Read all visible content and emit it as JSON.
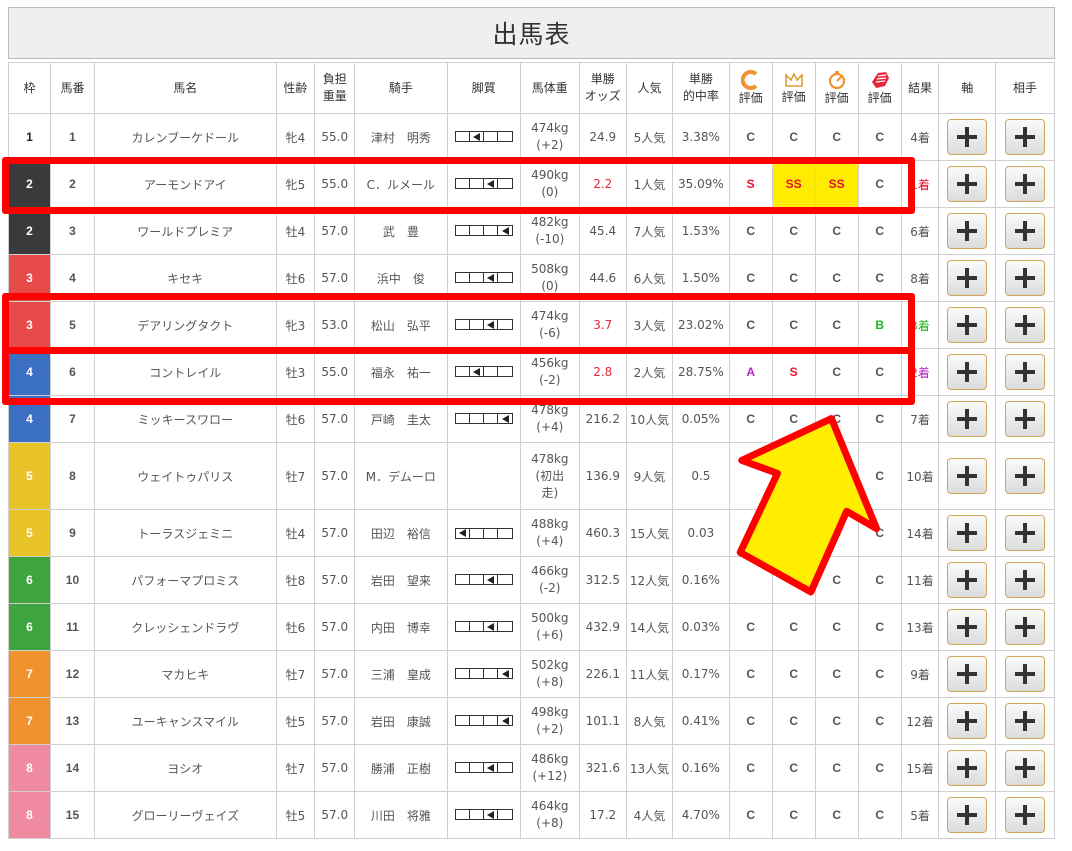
{
  "title": "出馬表",
  "headers": {
    "waku": "枠",
    "umaban": "馬番",
    "name": "馬名",
    "sexage": "性齢",
    "futan_1": "負担",
    "futan_2": "重量",
    "jockey": "騎手",
    "kyakushitsu": "脚質",
    "weight": "馬体重",
    "odds_1": "単勝",
    "odds_2": "オッズ",
    "pop": "人気",
    "hit_1": "単勝",
    "hit_2": "的中率",
    "eval": "評価",
    "result": "結果",
    "axis": "軸",
    "partner": "相手"
  },
  "header_icons": [
    "c-logo-icon",
    "crown-icon",
    "pot-icon",
    "fist-icon"
  ],
  "waku_colors": {
    "1": "#ffffff",
    "2": "#3a3a3a",
    "3": "#e84a4a",
    "4": "#3b6fc4",
    "5": "#e8c42a",
    "6": "#3ea53e",
    "7": "#f0922e",
    "8": "#f08aa0"
  },
  "rows": [
    {
      "waku": "1",
      "umaban": "1",
      "name": "カレンブーケドール",
      "sexage": "牝4",
      "futan": "55.0",
      "jockey": "津村　明秀",
      "kyaku": 2,
      "weight_1": "474kg",
      "weight_2": "(+2)",
      "odds": "24.9",
      "hot": false,
      "pop": "5人気",
      "hit": "3.38%",
      "g1": "C",
      "g2": "C",
      "g3": "C",
      "g4": "C",
      "result": "4着"
    },
    {
      "waku": "2",
      "umaban": "2",
      "name": "アーモンドアイ",
      "sexage": "牝5",
      "futan": "55.0",
      "jockey": "C．ルメール",
      "kyaku": 3,
      "weight_1": "490kg",
      "weight_2": "(0)",
      "odds": "2.2",
      "hot": true,
      "pop": "1人気",
      "hit": "35.09%",
      "g1": "S",
      "g2": "SS",
      "g3": "SS",
      "g4": "C",
      "result": "1着"
    },
    {
      "waku": "2",
      "umaban": "3",
      "name": "ワールドプレミア",
      "sexage": "牡4",
      "futan": "57.0",
      "jockey": "武　豊",
      "kyaku": 4,
      "weight_1": "482kg",
      "weight_2": "(-10)",
      "odds": "45.4",
      "hot": false,
      "pop": "7人気",
      "hit": "1.53%",
      "g1": "C",
      "g2": "C",
      "g3": "C",
      "g4": "C",
      "result": "6着"
    },
    {
      "waku": "3",
      "umaban": "4",
      "name": "キセキ",
      "sexage": "牡6",
      "futan": "57.0",
      "jockey": "浜中　俊",
      "kyaku": 3,
      "weight_1": "508kg",
      "weight_2": "(0)",
      "odds": "44.6",
      "hot": false,
      "pop": "6人気",
      "hit": "1.50%",
      "g1": "C",
      "g2": "C",
      "g3": "C",
      "g4": "C",
      "result": "8着"
    },
    {
      "waku": "3",
      "umaban": "5",
      "name": "デアリングタクト",
      "sexage": "牝3",
      "futan": "53.0",
      "jockey": "松山　弘平",
      "kyaku": 3,
      "weight_1": "474kg",
      "weight_2": "(-6)",
      "odds": "3.7",
      "hot": true,
      "pop": "3人気",
      "hit": "23.02%",
      "g1": "C",
      "g2": "C",
      "g3": "C",
      "g4": "B",
      "result": "3着"
    },
    {
      "waku": "4",
      "umaban": "6",
      "name": "コントレイル",
      "sexage": "牡3",
      "futan": "55.0",
      "jockey": "福永　祐一",
      "kyaku": 2,
      "weight_1": "456kg",
      "weight_2": "(-2)",
      "odds": "2.8",
      "hot": true,
      "pop": "2人気",
      "hit": "28.75%",
      "g1": "A",
      "g2": "S",
      "g3": "C",
      "g4": "C",
      "result": "2着"
    },
    {
      "waku": "4",
      "umaban": "7",
      "name": "ミッキースワロー",
      "sexage": "牡6",
      "futan": "57.0",
      "jockey": "戸崎　圭太",
      "kyaku": 4,
      "weight_1": "478kg",
      "weight_2": "(+4)",
      "odds": "216.2",
      "hot": false,
      "pop": "10人気",
      "hit": "0.05%",
      "g1": "C",
      "g2": "C",
      "g3": "C",
      "g4": "C",
      "result": "7着"
    },
    {
      "waku": "5",
      "umaban": "8",
      "name": "ウェイトゥパリス",
      "sexage": "牡7",
      "futan": "57.0",
      "jockey": "M．デムーロ",
      "kyaku": 0,
      "weight_1": "478kg",
      "weight_2": "(初出",
      "weight_3": "走)",
      "odds": "136.9",
      "hot": false,
      "pop": "9人気",
      "hit": "0.5",
      "g1": "",
      "g2": "",
      "g3": "C",
      "g4": "C",
      "result": "10着"
    },
    {
      "waku": "5",
      "umaban": "9",
      "name": "トーラスジェミニ",
      "sexage": "牡4",
      "futan": "57.0",
      "jockey": "田辺　裕信",
      "kyaku": 1,
      "weight_1": "488kg",
      "weight_2": "(+4)",
      "odds": "460.3",
      "hot": false,
      "pop": "15人気",
      "hit": "0.03",
      "g1": "",
      "g2": "",
      "g3": "C",
      "g4": "C",
      "result": "14着"
    },
    {
      "waku": "6",
      "umaban": "10",
      "name": "パフォーマプロミス",
      "sexage": "牡8",
      "futan": "57.0",
      "jockey": "岩田　望来",
      "kyaku": 3,
      "weight_1": "466kg",
      "weight_2": "(-2)",
      "odds": "312.5",
      "hot": false,
      "pop": "12人気",
      "hit": "0.16%",
      "g1": "",
      "g2": "",
      "g3": "C",
      "g4": "C",
      "result": "11着"
    },
    {
      "waku": "6",
      "umaban": "11",
      "name": "クレッシェンドラヴ",
      "sexage": "牡6",
      "futan": "57.0",
      "jockey": "内田　博幸",
      "kyaku": 3,
      "weight_1": "500kg",
      "weight_2": "(+6)",
      "odds": "432.9",
      "hot": false,
      "pop": "14人気",
      "hit": "0.03%",
      "g1": "C",
      "g2": "C",
      "g3": "C",
      "g4": "C",
      "result": "13着"
    },
    {
      "waku": "7",
      "umaban": "12",
      "name": "マカヒキ",
      "sexage": "牡7",
      "futan": "57.0",
      "jockey": "三浦　皇成",
      "kyaku": 4,
      "weight_1": "502kg",
      "weight_2": "(+8)",
      "odds": "226.1",
      "hot": false,
      "pop": "11人気",
      "hit": "0.17%",
      "g1": "C",
      "g2": "C",
      "g3": "C",
      "g4": "C",
      "result": "9着"
    },
    {
      "waku": "7",
      "umaban": "13",
      "name": "ユーキャンスマイル",
      "sexage": "牡5",
      "futan": "57.0",
      "jockey": "岩田　康誠",
      "kyaku": 4,
      "weight_1": "498kg",
      "weight_2": "(+2)",
      "odds": "101.1",
      "hot": false,
      "pop": "8人気",
      "hit": "0.41%",
      "g1": "C",
      "g2": "C",
      "g3": "C",
      "g4": "C",
      "result": "12着"
    },
    {
      "waku": "8",
      "umaban": "14",
      "name": "ヨシオ",
      "sexage": "牡7",
      "futan": "57.0",
      "jockey": "勝浦　正樹",
      "kyaku": 3,
      "weight_1": "486kg",
      "weight_2": "(+12)",
      "odds": "321.6",
      "hot": false,
      "pop": "13人気",
      "hit": "0.16%",
      "g1": "C",
      "g2": "C",
      "g3": "C",
      "g4": "C",
      "result": "15着"
    },
    {
      "waku": "8",
      "umaban": "15",
      "name": "グローリーヴェイズ",
      "sexage": "牡5",
      "futan": "57.0",
      "jockey": "川田　将雅",
      "kyaku": 3,
      "weight_1": "464kg",
      "weight_2": "(+8)",
      "odds": "17.2",
      "hot": false,
      "pop": "4人気",
      "hit": "4.70%",
      "g1": "C",
      "g2": "C",
      "g3": "C",
      "g4": "C",
      "result": "5着"
    }
  ],
  "highlight_color": "#ff0000",
  "arrow_color": "#ffee00"
}
